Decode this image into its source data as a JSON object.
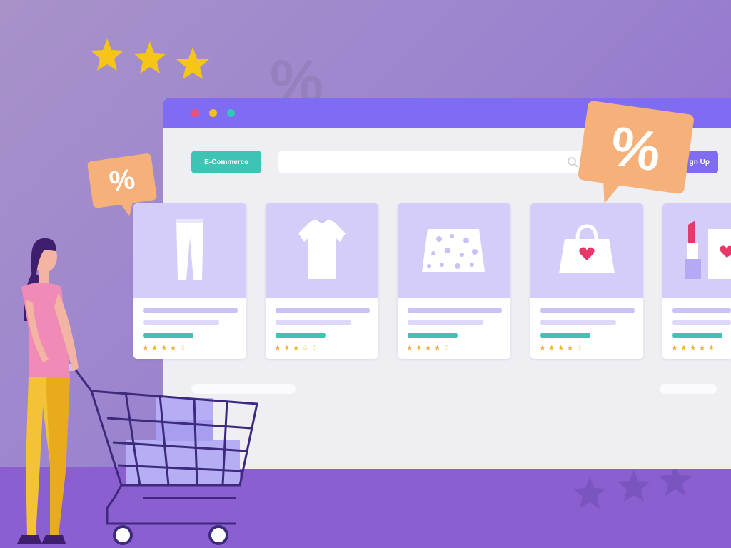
{
  "header": {
    "brand_label": "E-Commerce",
    "signup_label": "gn Up"
  },
  "badges": {
    "small_symbol": "%",
    "big_symbol": "%",
    "background_symbol": "%"
  },
  "products": [
    {
      "icon": "pants-icon",
      "rating": "★★★★☆"
    },
    {
      "icon": "tshirt-icon",
      "rating": "★★★☆☆"
    },
    {
      "icon": "skirt-icon",
      "rating": "★★★★☆"
    },
    {
      "icon": "handbag-icon",
      "rating": "★★★★☆"
    },
    {
      "icon": "lipstick-icon",
      "rating": "★★★★★"
    }
  ],
  "colors": {
    "accent": "#7f6cf3",
    "teal": "#3dc4b4",
    "badge": "#f6b07a",
    "star": "#f3b81d"
  }
}
